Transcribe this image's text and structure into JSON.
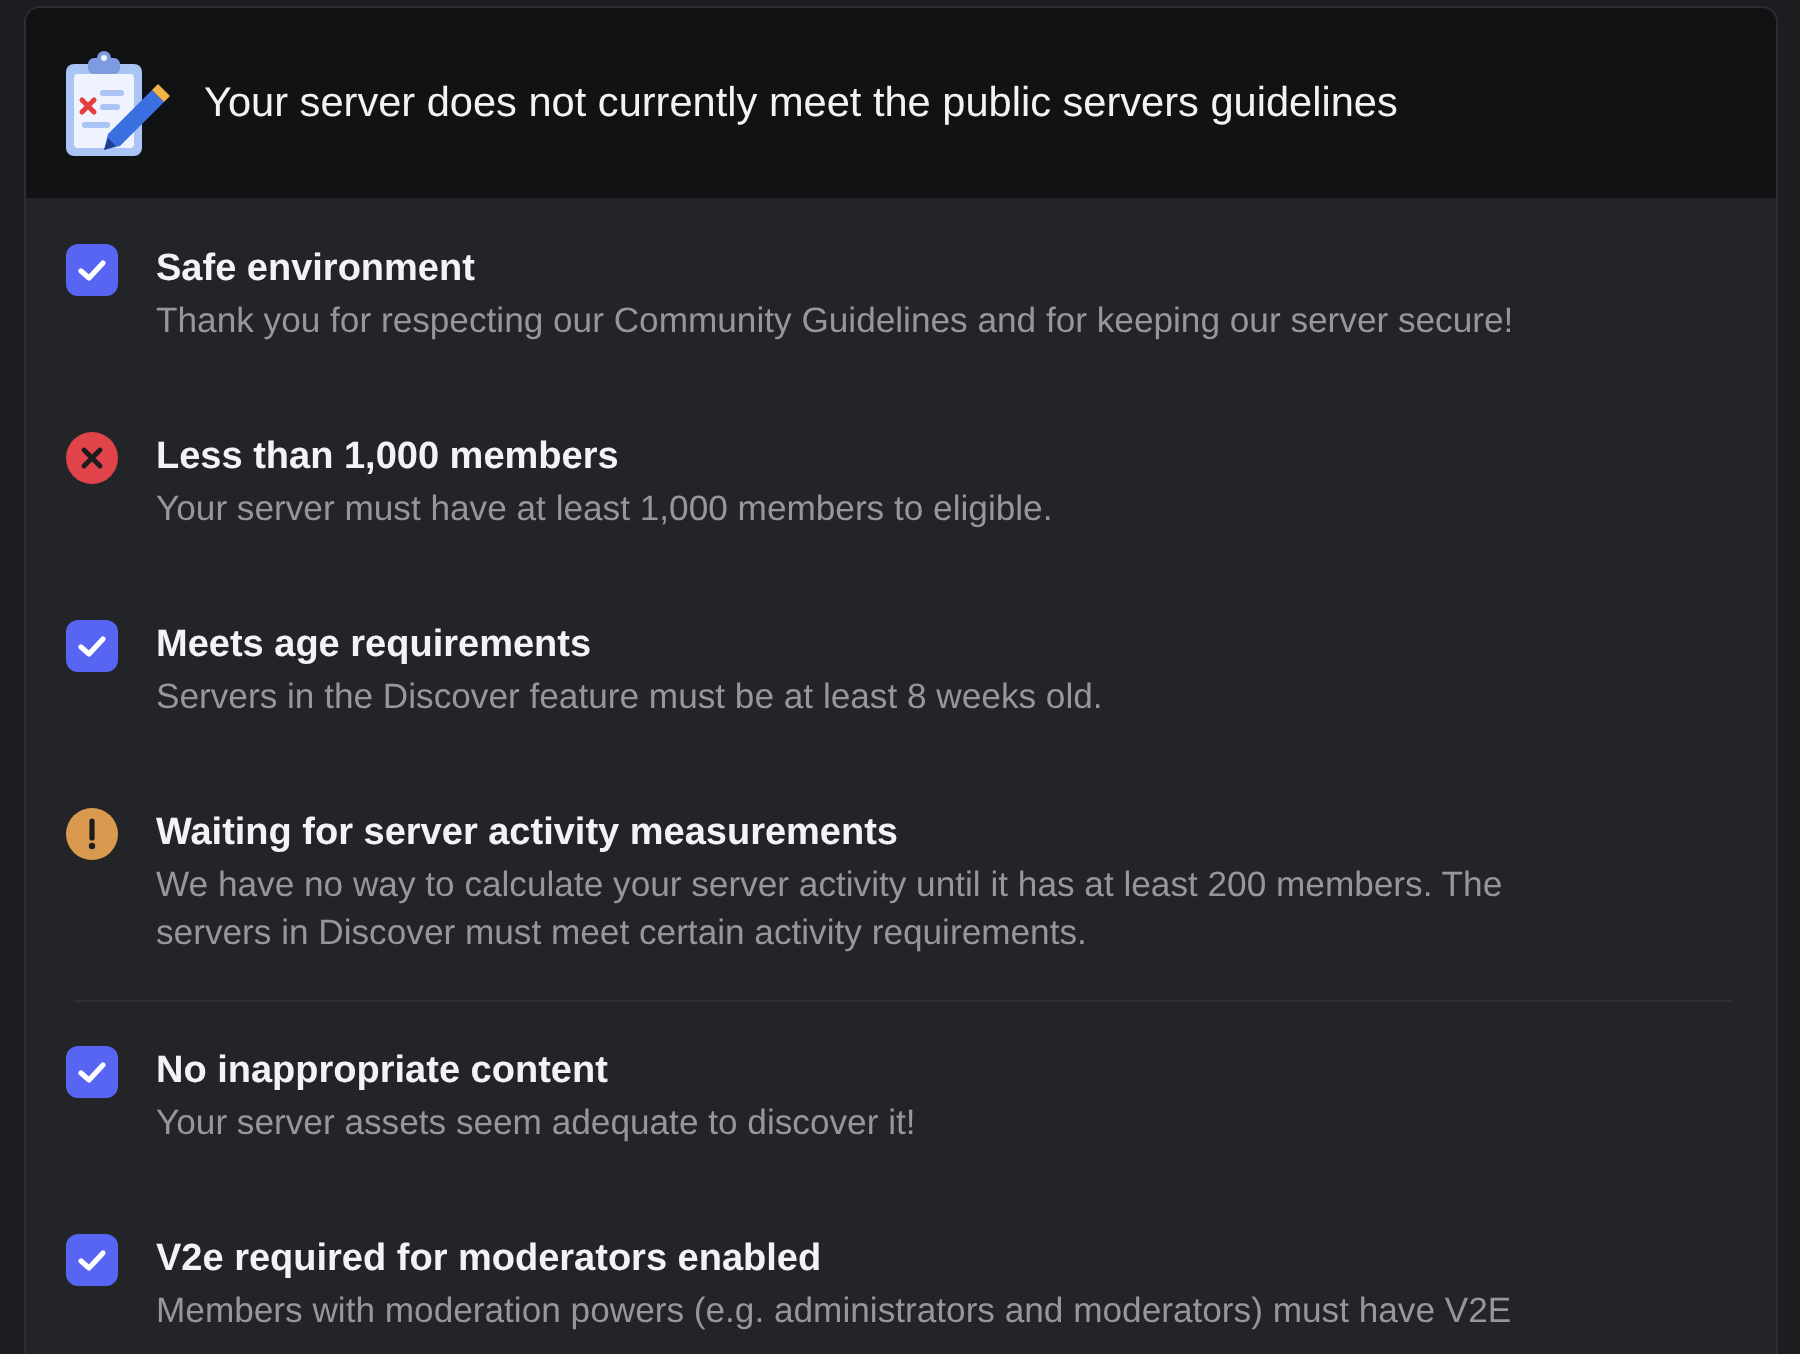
{
  "header": {
    "title": "Your server does not currently meet the public servers guidelines"
  },
  "requirements": [
    {
      "kind": "passed",
      "title": "Safe environment",
      "description": "Thank you for respecting our Community Guidelines and for keeping our server secure!",
      "divider_below": false
    },
    {
      "kind": "failed",
      "title": "Less than 1,000 members",
      "description": "Your server must have at least 1,000 members to eligible.",
      "divider_below": false
    },
    {
      "kind": "passed",
      "title": "Meets age requirements",
      "description": "Servers in the Discover feature must be at least 8 weeks old.",
      "divider_below": false
    },
    {
      "kind": "pending",
      "title": "Waiting for server activity measurements",
      "description": "We have no way to calculate your server activity until it has at least 200 members. The servers in Discover must meet certain activity requirements.",
      "divider_below": true
    },
    {
      "kind": "passed",
      "title": "No inappropriate content",
      "description": "Your server assets seem adequate to discover it!",
      "divider_below": false
    },
    {
      "kind": "passed",
      "title": "V2e required for moderators enabled",
      "description": "Members with moderation powers (e.g. administrators and moderators) must have V2E",
      "divider_below": false
    }
  ]
}
